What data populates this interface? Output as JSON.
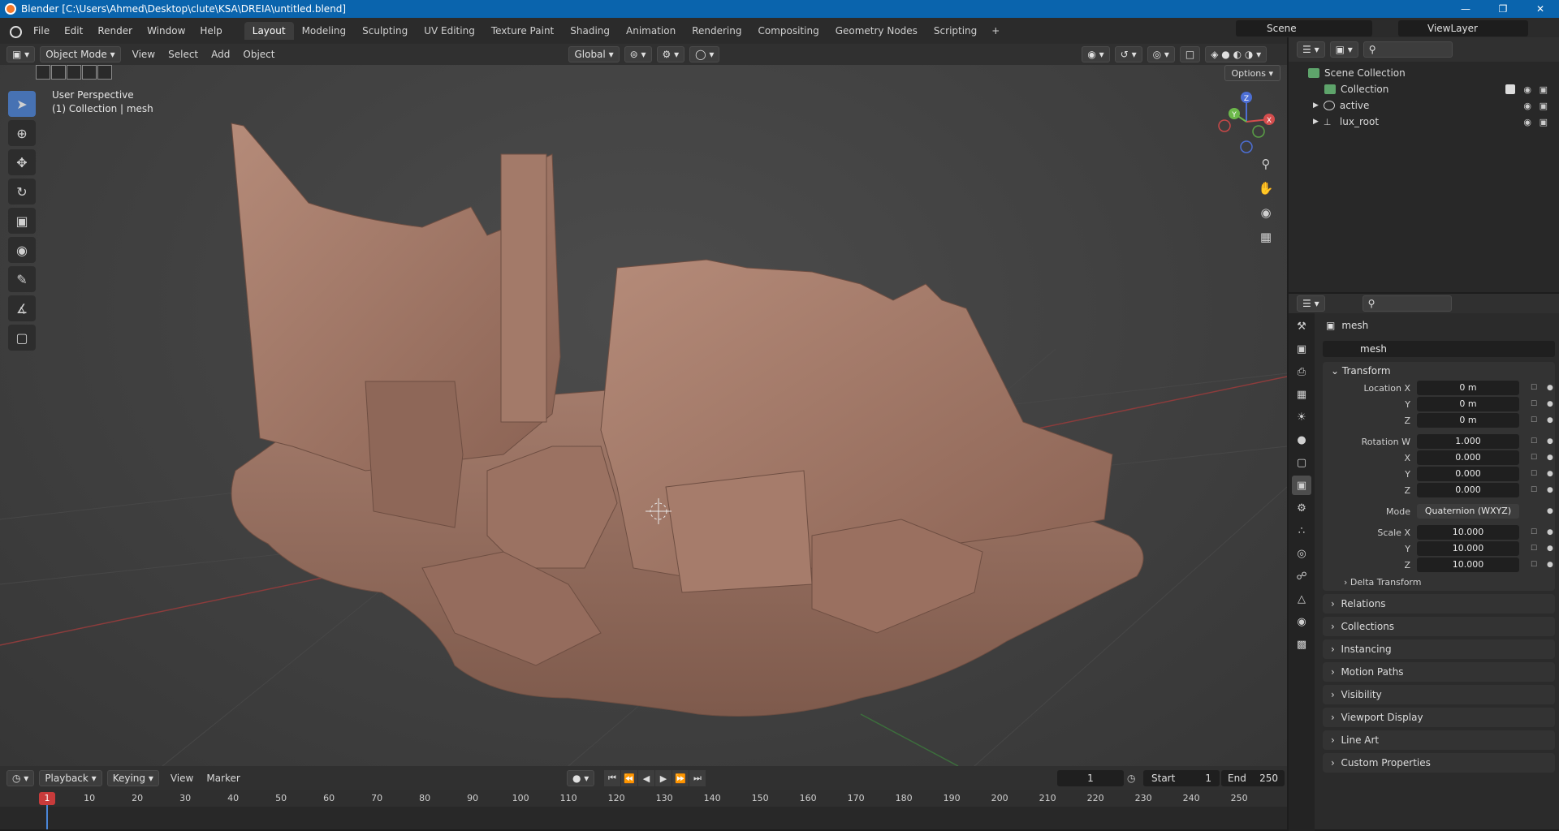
{
  "window": {
    "title": "Blender [C:\\Users\\Ahmed\\Desktop\\clute\\KSA\\DREIA\\untitled.blend]"
  },
  "menu": {
    "items": [
      "File",
      "Edit",
      "Render",
      "Window",
      "Help"
    ]
  },
  "workspaces": [
    "Layout",
    "Modeling",
    "Sculpting",
    "UV Editing",
    "Texture Paint",
    "Shading",
    "Animation",
    "Rendering",
    "Compositing",
    "Geometry Nodes",
    "Scripting"
  ],
  "active_workspace": "Layout",
  "scene": {
    "name": "Scene",
    "view_layer": "ViewLayer"
  },
  "viewport_header": {
    "mode": "Object Mode",
    "menus": [
      "View",
      "Select",
      "Add",
      "Object"
    ],
    "orientation": "Global",
    "options_label": "Options"
  },
  "viewport": {
    "perspective": "User Perspective",
    "collection_info": "(1) Collection | mesh",
    "gizmo_labels": [
      "Z",
      "Y",
      "X"
    ]
  },
  "outliner": {
    "items": [
      {
        "label": "Scene Collection",
        "icon": "scene-collection-icon"
      },
      {
        "label": "Collection",
        "icon": "collection-icon"
      },
      {
        "label": "active",
        "icon": "object-icon"
      },
      {
        "label": "lux_root",
        "icon": "empty-icon"
      }
    ]
  },
  "properties": {
    "object_name": "mesh",
    "name_field": "mesh",
    "transform": {
      "title": "Transform",
      "location": {
        "label": "Location X",
        "x": "0 m",
        "y": "0 m",
        "z": "0 m"
      },
      "rotation": {
        "label": "Rotation W",
        "w": "1.000",
        "x": "0.000",
        "y": "0.000",
        "z": "0.000"
      },
      "mode_label": "Mode",
      "mode": "Quaternion (WXYZ)",
      "scale": {
        "label": "Scale X",
        "x": "10.000",
        "y": "10.000",
        "z": "10.000"
      },
      "axis_y": "Y",
      "axis_z": "Z",
      "axis_x": "X",
      "delta": "Delta Transform"
    },
    "collapsed_panels": [
      "Relations",
      "Collections",
      "Instancing",
      "Motion Paths",
      "Visibility",
      "Viewport Display",
      "Line Art",
      "Custom Properties"
    ]
  },
  "timeline": {
    "menus": [
      "Playback",
      "Keying",
      "View",
      "Marker"
    ],
    "current_frame": "1",
    "start_label": "Start",
    "start": "1",
    "end_label": "End",
    "end": "250",
    "ruler_frames": [
      "1",
      "10",
      "20",
      "30",
      "40",
      "50",
      "60",
      "70",
      "80",
      "90",
      "100",
      "110",
      "120",
      "130",
      "140",
      "150",
      "160",
      "170",
      "180",
      "190",
      "200",
      "210",
      "220",
      "230",
      "240",
      "250"
    ]
  },
  "colors": {
    "accent": "#4772b3",
    "titlebar": "#0a64ad",
    "model": "#9c7464",
    "frame_marker": "#c83b3b"
  }
}
